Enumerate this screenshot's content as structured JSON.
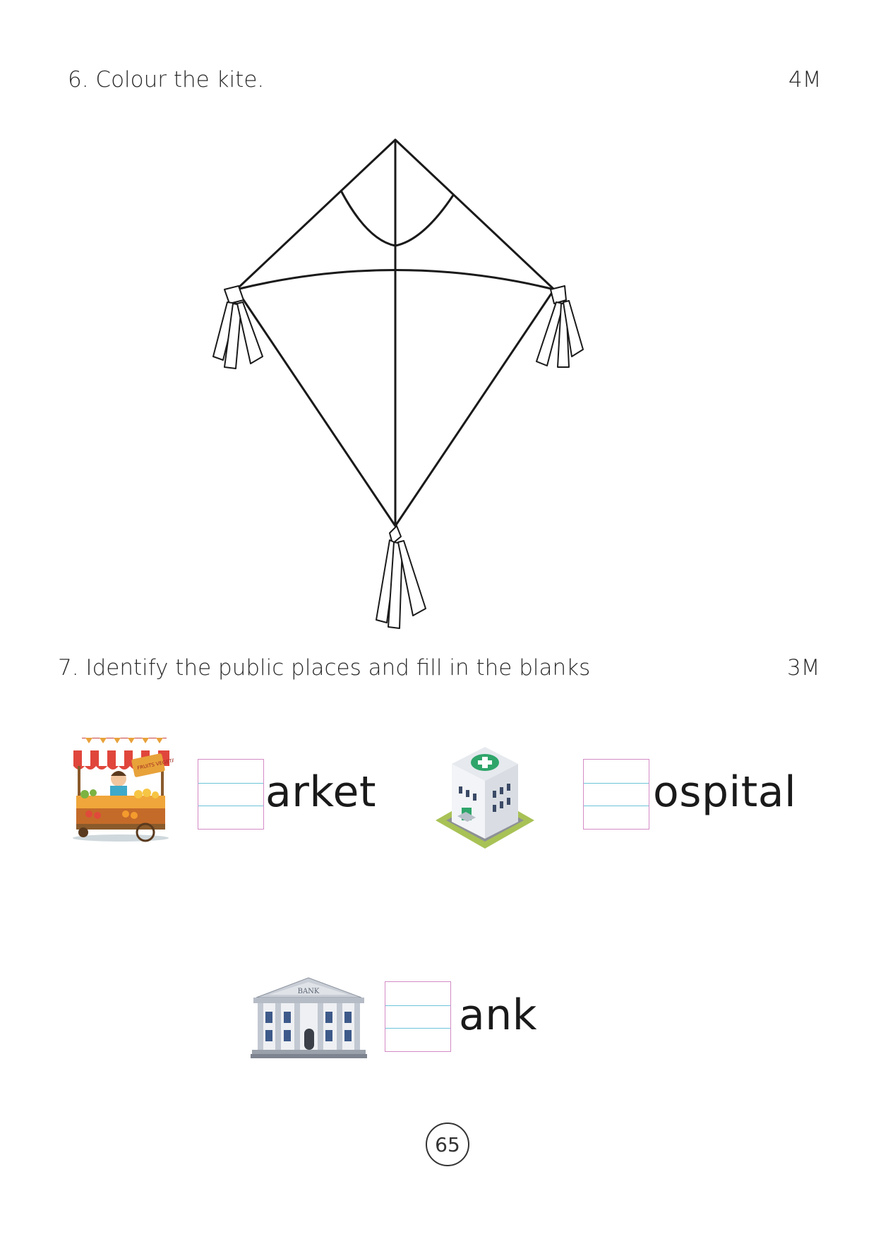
{
  "q6": {
    "title": "6. Colour the kite.",
    "marks": "4M"
  },
  "q7": {
    "title": "7. Identify the public places and fill in the blanks",
    "marks": "3M",
    "items": [
      {
        "word": "arket",
        "image": "market-stall-image",
        "sign": "FRUITS VEGETABLES"
      },
      {
        "word": "ospital",
        "image": "hospital-building-image"
      },
      {
        "word": "ank",
        "image": "bank-building-image",
        "sign": "BANK"
      }
    ]
  },
  "page_number": "65",
  "colors": {
    "pink_border": "#d48bc6",
    "blue_line": "#6cc4d9",
    "stall_red": "#e0463c",
    "hospital_green": "#2fa56a"
  }
}
